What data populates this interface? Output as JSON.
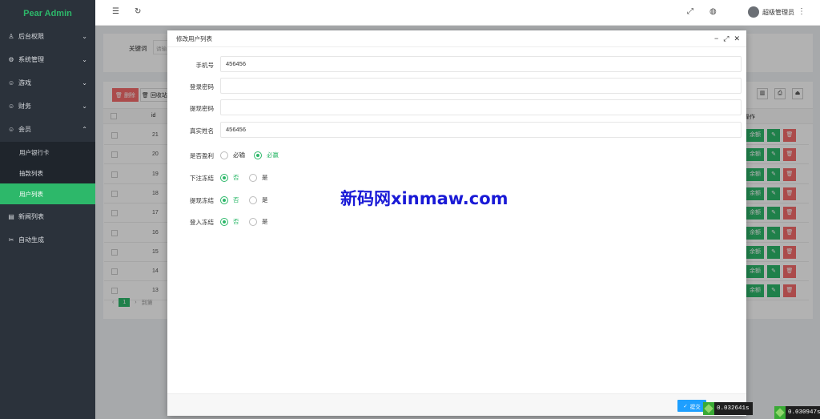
{
  "sidebar": {
    "logo": "Pear Admin",
    "menu": [
      {
        "label": "后台权限",
        "icon": "user-icon",
        "chevron": "⌄"
      },
      {
        "label": "系统管理",
        "icon": "gear-icon",
        "chevron": "⌄"
      },
      {
        "label": "游戏",
        "icon": "smile-icon",
        "chevron": "⌄"
      },
      {
        "label": "财务",
        "icon": "smile-icon",
        "chevron": "⌄"
      },
      {
        "label": "会员",
        "icon": "smile-icon",
        "chevron": "⌃"
      },
      {
        "label": "新闻列表",
        "icon": "news-icon"
      },
      {
        "label": "自动生成",
        "icon": "tool-icon"
      }
    ],
    "submenu": [
      {
        "label": "用户银行卡"
      },
      {
        "label": "抽款列表"
      },
      {
        "label": "用户列表",
        "active": true
      }
    ]
  },
  "topbar": {
    "user_name": "超级管理员"
  },
  "background": {
    "search_label": "关键词",
    "search_placeholder": "请输",
    "delete_label": "删除",
    "recycle_label": "回收站",
    "col_id": "id",
    "col_action": "操作",
    "ids": [
      "21",
      "20",
      "19",
      "18",
      "17",
      "16",
      "15",
      "14",
      "13"
    ],
    "balance_btn": "余额",
    "page": "1",
    "page_suffix": "到第"
  },
  "dialog": {
    "title": "修改用户列表",
    "fields": {
      "phone_label": "手机号",
      "phone_value": "456456",
      "login_pwd_label": "登录密码",
      "login_pwd_value": "",
      "withdraw_pwd_label": "提现密码",
      "withdraw_pwd_value": "",
      "realname_label": "真实姓名",
      "realname_value": "456456",
      "profit_label": "是否盈利",
      "profit_opt1": "必输",
      "profit_opt2": "必赢",
      "bet_freeze_label": "下注冻结",
      "withdraw_freeze_label": "提现冻结",
      "login_freeze_label": "登入冻结",
      "no_label": "否",
      "yes_label": "是"
    },
    "submit_label": "提交"
  },
  "watermark": "新码网xinmaw.com",
  "timers": [
    "0.032641s",
    "0.030947s"
  ]
}
